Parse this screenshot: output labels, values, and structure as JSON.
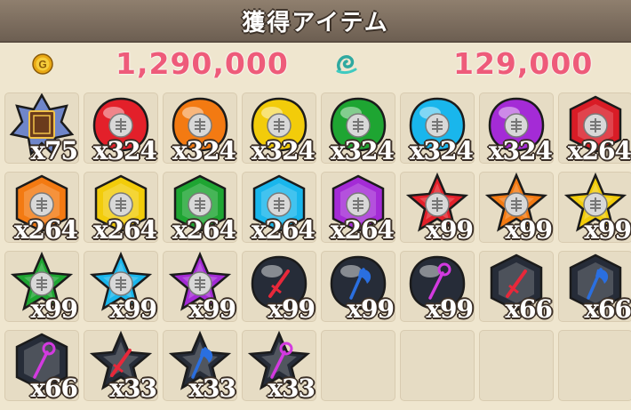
{
  "title": "獲得アイテム",
  "currency": {
    "gold": {
      "icon": "gold-coin-icon",
      "value": "1,290,000"
    },
    "spirit": {
      "icon": "spirit-swirl-icon",
      "value": "129,000"
    }
  },
  "items": [
    {
      "icon": "star-tome-icon",
      "color": "#3b4a8a",
      "qty": "x75"
    },
    {
      "icon": "red-orb-icon",
      "color": "#e3202a",
      "qty": "x324"
    },
    {
      "icon": "orange-orb-icon",
      "color": "#f37a12",
      "qty": "x324"
    },
    {
      "icon": "yellow-orb-icon",
      "color": "#f2cc0a",
      "qty": "x324"
    },
    {
      "icon": "green-orb-icon",
      "color": "#1ea532",
      "qty": "x324"
    },
    {
      "icon": "cyan-orb-icon",
      "color": "#19b6ec",
      "qty": "x324"
    },
    {
      "icon": "purple-orb-icon",
      "color": "#a42bd6",
      "qty": "x324"
    },
    {
      "icon": "red-hexagon-gem-icon",
      "color": "#d91c26",
      "qty": "x264"
    },
    {
      "icon": "orange-hexagon-gem-icon",
      "color": "#f37a12",
      "qty": "x264"
    },
    {
      "icon": "yellow-hexagon-gem-icon",
      "color": "#f2cc0a",
      "qty": "x264"
    },
    {
      "icon": "green-hexagon-gem-icon",
      "color": "#1ea532",
      "qty": "x264"
    },
    {
      "icon": "cyan-hexagon-gem-icon",
      "color": "#19b6ec",
      "qty": "x264"
    },
    {
      "icon": "purple-hexagon-gem-icon",
      "color": "#a42bd6",
      "qty": "x264"
    },
    {
      "icon": "red-star-gem-icon",
      "color": "#e3202a",
      "qty": "x99"
    },
    {
      "icon": "orange-star-gem-icon",
      "color": "#f37a12",
      "qty": "x99"
    },
    {
      "icon": "yellow-star-gem-icon",
      "color": "#f2cc0a",
      "qty": "x99"
    },
    {
      "icon": "green-star-gem-icon",
      "color": "#1ea532",
      "qty": "x99"
    },
    {
      "icon": "cyan-star-gem-icon",
      "color": "#19b6ec",
      "qty": "x99"
    },
    {
      "icon": "purple-star-gem-icon",
      "color": "#a42bd6",
      "qty": "x99"
    },
    {
      "icon": "dark-orb-sword-icon",
      "color": "#e8283a",
      "qty": "x99"
    },
    {
      "icon": "dark-orb-axe-icon",
      "color": "#2a6fe0",
      "qty": "x99"
    },
    {
      "icon": "dark-orb-staff-icon",
      "color": "#d33ae0",
      "qty": "x99"
    },
    {
      "icon": "dark-hexagon-sword-icon",
      "color": "#e8283a",
      "qty": "x66"
    },
    {
      "icon": "dark-hexagon-axe-icon",
      "color": "#2a6fe0",
      "qty": "x66"
    },
    {
      "icon": "dark-hexagon-staff-icon",
      "color": "#d33ae0",
      "qty": "x66"
    },
    {
      "icon": "dark-star-sword-icon",
      "color": "#e8283a",
      "qty": "x33"
    },
    {
      "icon": "dark-star-axe-icon",
      "color": "#2a6fe0",
      "qty": "x33"
    },
    {
      "icon": "dark-star-staff-icon",
      "color": "#d33ae0",
      "qty": "x33"
    }
  ],
  "empty_slots": 4
}
